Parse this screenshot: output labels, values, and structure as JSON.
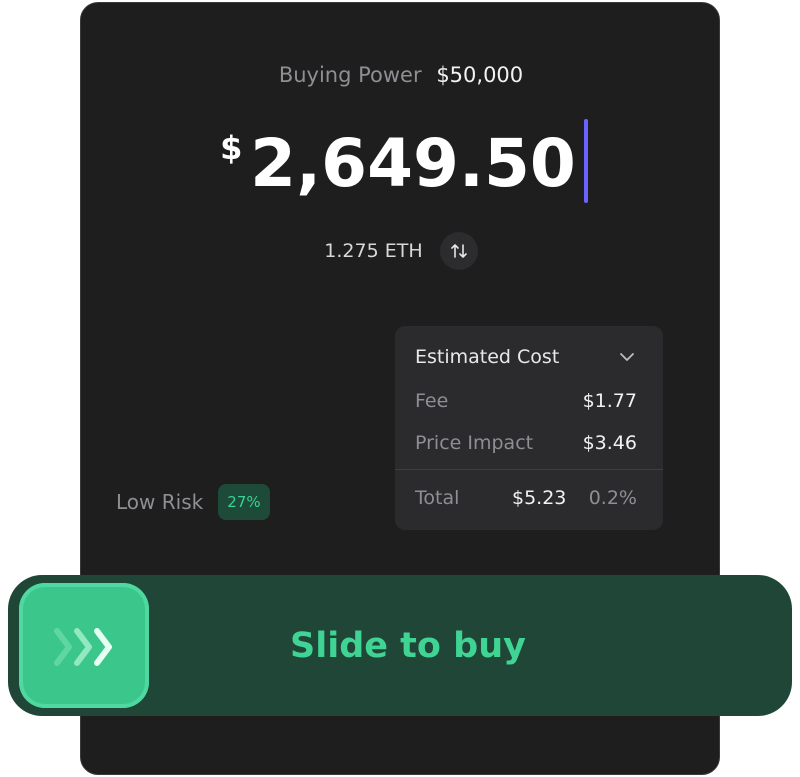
{
  "buying_power": {
    "label": "Buying Power",
    "value": "$50,000"
  },
  "amount": {
    "currency_symbol": "$",
    "value": "2,649.50"
  },
  "conversion": {
    "value": "1.275 ETH",
    "swap_icon": "swap-vertical-icon"
  },
  "estimated_cost": {
    "title": "Estimated Cost",
    "toggle_icon": "chevron-down-icon",
    "rows": [
      {
        "label": "Fee",
        "value": "$1.77"
      },
      {
        "label": "Price Impact",
        "value": "$3.46"
      }
    ],
    "total": {
      "label": "Total",
      "value": "$5.23",
      "percent": "0.2%"
    }
  },
  "risk": {
    "label": "Low Risk",
    "badge": "27%"
  },
  "slide_action": {
    "label": "Slide to buy",
    "handle_icon": "triple-chevron-right-icon"
  },
  "colors": {
    "panel_bg": "#1e1e1f",
    "caret": "#6b63ff",
    "accent_green": "#3bc68b",
    "slider_track": "#1f4636"
  }
}
